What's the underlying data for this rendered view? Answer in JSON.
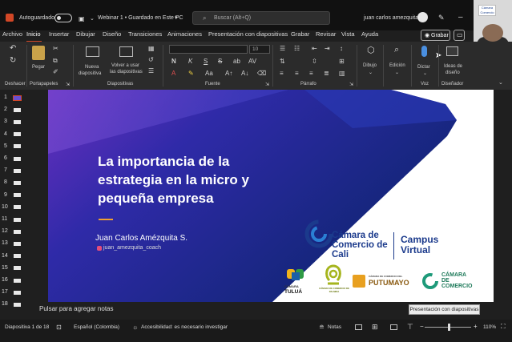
{
  "titlebar": {
    "autosave_label": "Autoguardado",
    "doc_title": "Webinar 1 • Guardado en Este PC",
    "search_placeholder": "Buscar (Alt+Q)",
    "user_name": "juan carlos amezquita",
    "camera_logo_text": "Cámara Comercio"
  },
  "tabs": [
    "Archivo",
    "Inicio",
    "Insertar",
    "Dibujar",
    "Diseño",
    "Transiciones",
    "Animaciones",
    "Presentación con diapositivas",
    "Grabar",
    "Revisar",
    "Vista",
    "Ayuda"
  ],
  "active_tab": "Inicio",
  "grabar_button": "Grabar",
  "ribbon": {
    "undo_label": "Deshacer",
    "clipboard": {
      "paste": "Pegar",
      "group": "Portapapeles"
    },
    "slides": {
      "new_slide": [
        "Nueva",
        "diapositiva"
      ],
      "reuse": [
        "Volver a usar",
        "las diapositivas"
      ],
      "group": "Diapositivas"
    },
    "font": {
      "size": "10",
      "group": "Fuente"
    },
    "paragraph": {
      "group": "Párrafo"
    },
    "draw": "Dibujo",
    "edit": "Edición",
    "voice": {
      "dictate": "Dictar",
      "group": "Voz"
    },
    "designer": {
      "ideas": [
        "Ideas de",
        "diseño"
      ],
      "group": "Diseñador"
    }
  },
  "thumbnails": [
    "1",
    "2",
    "3",
    "4",
    "5",
    "6",
    "7",
    "8",
    "9",
    "10",
    "11",
    "12",
    "13",
    "14",
    "15",
    "16",
    "17",
    "18"
  ],
  "slide": {
    "title_lines": [
      "La importancia de la",
      "estrategia en la micro y",
      "pequeña empresa"
    ],
    "presenter": "Juan Carlos Amézquita S.",
    "handle": "juan_amezquita_coach",
    "ccc_lines": [
      "Cámara de",
      "Comercio de",
      "Cali"
    ],
    "campus_lines": [
      "Campus",
      "Virtual"
    ],
    "chambers": {
      "tulua": [
        "CÁMARA",
        "TULUÁ"
      ],
      "palmira": "CÁMARA DE COMERCIO DE PALMIRA",
      "putumayo_top": "CÁMARA DE COMERCIO DEL",
      "putumayo": "PUTUMAYO",
      "cdc": [
        "CÁMARA",
        "DE",
        "COMERCIO"
      ]
    },
    "colors": {
      "primary": "#1b3a8c",
      "accent": "#f0a030",
      "gradient_start": "#6a2fc0",
      "gradient_end": "#0e2570"
    }
  },
  "notes_placeholder": "Pulsar para agregar notas",
  "tooltip": "Presentación con diapositivas",
  "status": {
    "slide_counter": "Diapositiva 1 de 18",
    "language": "Español (Colombia)",
    "accessibility": "Accesibilidad: es necesario investigar",
    "notes": "Notas",
    "zoom": "110%",
    "zoom_minus": "−",
    "zoom_plus": "+"
  }
}
